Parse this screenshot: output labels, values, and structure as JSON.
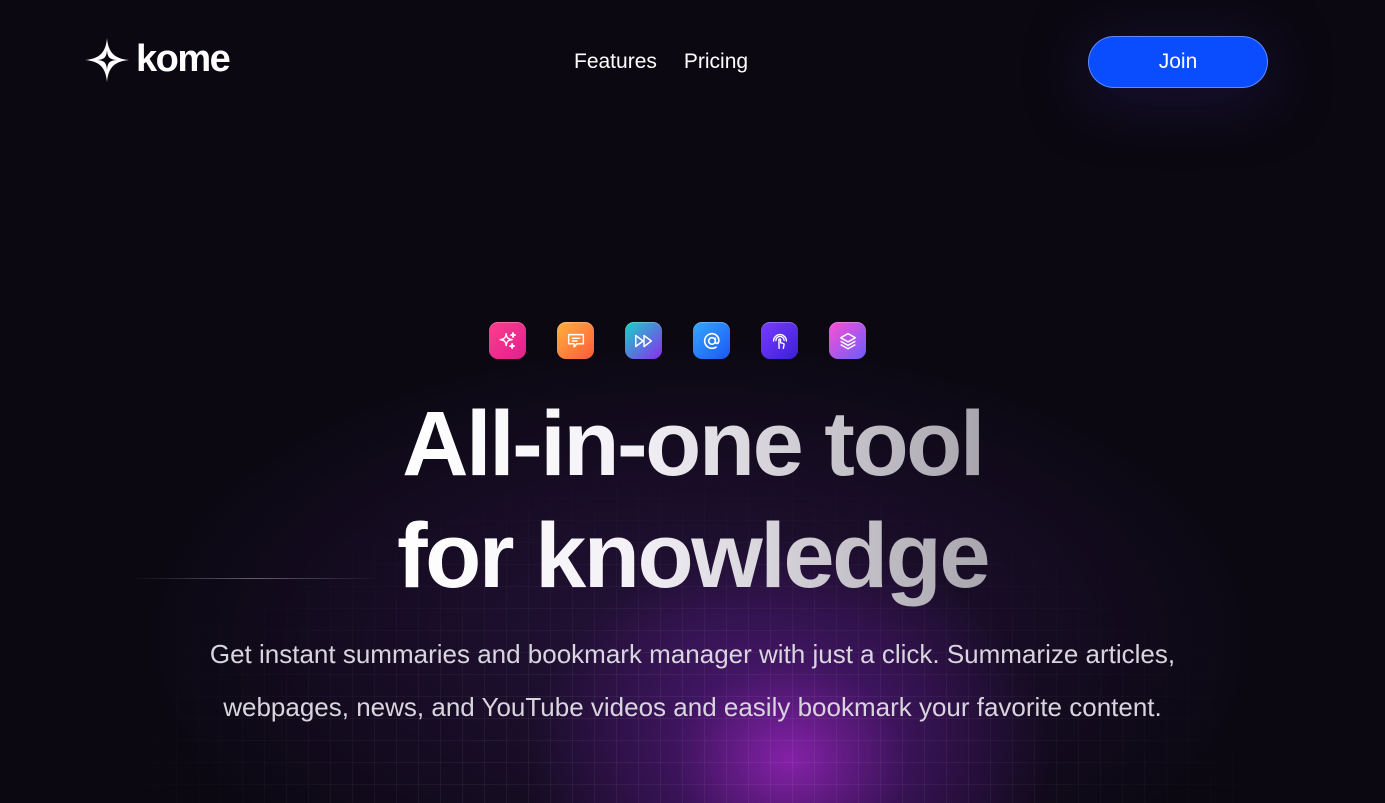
{
  "brand": {
    "name": "kome"
  },
  "nav": {
    "items": [
      {
        "label": "Features"
      },
      {
        "label": "Pricing"
      }
    ]
  },
  "header": {
    "join_label": "Join"
  },
  "feature_icons": [
    {
      "icon": "sparkle-icon",
      "color": "#ff3d8b"
    },
    {
      "icon": "chat-icon",
      "color": "#ff8a3a"
    },
    {
      "icon": "fast-forward-icon",
      "color": "#5a7cf0"
    },
    {
      "icon": "at-sign-icon",
      "color": "#2a7dfa"
    },
    {
      "icon": "touch-icon",
      "color": "#5a2ef0"
    },
    {
      "icon": "layers-icon",
      "color": "#b65be8"
    }
  ],
  "hero": {
    "headline_line1": "All-in-one tool",
    "headline_line2": "for knowledge",
    "subtitle_line1": "Get instant summaries and bookmark manager with just a click. Summarize articles,",
    "subtitle_line2": "webpages, news, and YouTube videos and easily bookmark your favorite content."
  },
  "colors": {
    "background": "#0b0812",
    "accent": "#0a4cff",
    "glow": "#a828d2"
  }
}
